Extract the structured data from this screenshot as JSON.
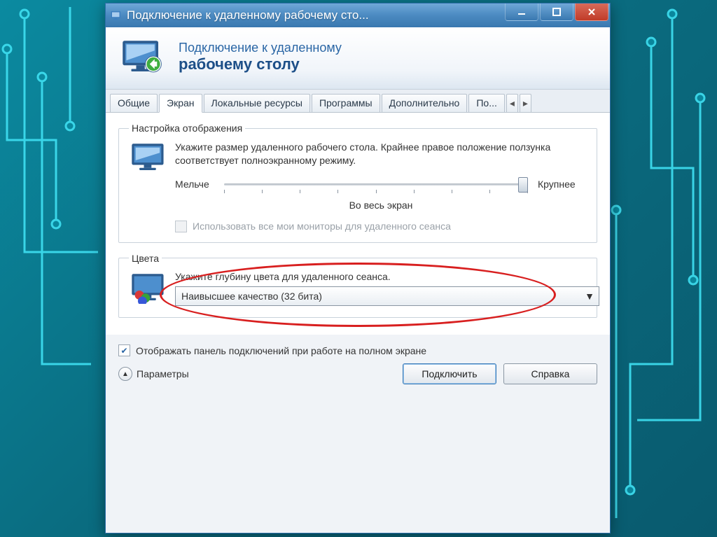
{
  "window_title": "Подключение к удаленному рабочему сто...",
  "header": {
    "line1": "Подключение к удаленному",
    "line2": "рабочему столу"
  },
  "tabs": {
    "items": [
      "Общие",
      "Экран",
      "Локальные ресурсы",
      "Программы",
      "Дополнительно",
      "По..."
    ],
    "active_index": 1
  },
  "display_group": {
    "legend": "Настройка отображения",
    "description": "Укажите размер удаленного рабочего стола. Крайнее правое положение ползунка соответствует полноэкранному режиму.",
    "slider_min_label": "Мельче",
    "slider_max_label": "Крупнее",
    "slider_caption": "Во весь экран",
    "all_monitors_label": "Использовать все мои мониторы для удаленного сеанса"
  },
  "colors_group": {
    "legend": "Цвета",
    "description": "Укажите глубину цвета для удаленного сеанса.",
    "combo_value": "Наивысшее качество (32 бита)"
  },
  "footer_checkbox": "Отображать панель подключений при работе на полном экране",
  "buttons": {
    "options": "Параметры",
    "connect": "Подключить",
    "help": "Справка"
  }
}
